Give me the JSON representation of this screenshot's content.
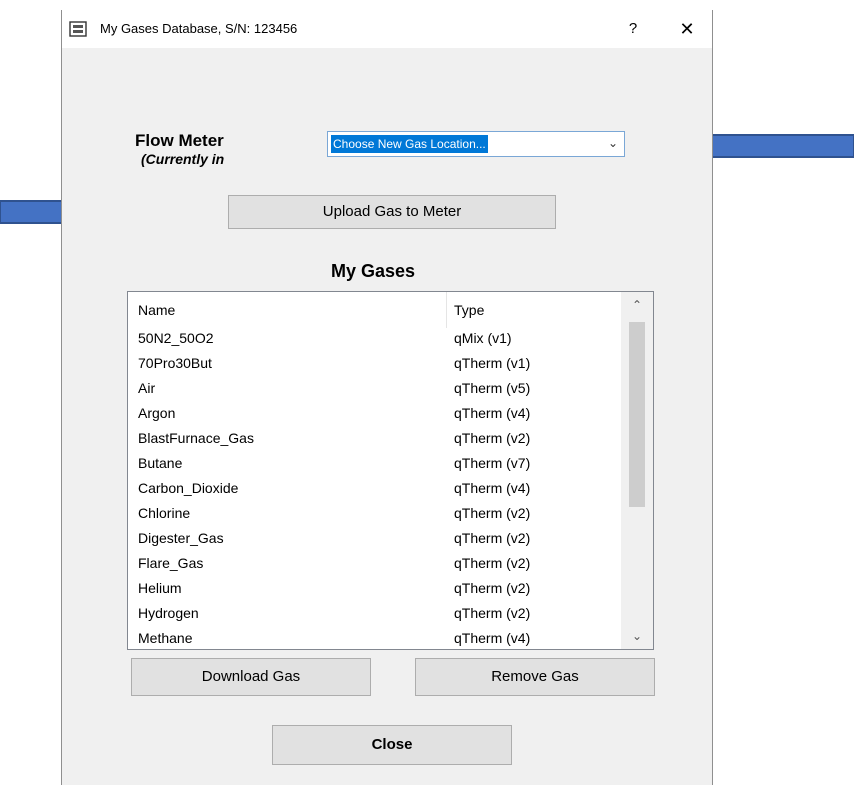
{
  "window": {
    "title": "My Gases Database, S/N: 123456",
    "help_label": "?",
    "close_label": "✕"
  },
  "flow_meter": {
    "label": "Flow Meter",
    "sublabel": "(Currently in",
    "dropdown_selected": "Choose New Gas Location...",
    "upload_button": "Upload Gas to Meter"
  },
  "my_gases": {
    "title": "My Gases",
    "columns": [
      "Name",
      "Type"
    ],
    "rows": [
      {
        "name": "50N2_50O2",
        "type": "qMix (v1)"
      },
      {
        "name": "70Pro30But",
        "type": "qTherm (v1)"
      },
      {
        "name": "Air",
        "type": "qTherm (v5)"
      },
      {
        "name": "Argon",
        "type": "qTherm (v4)"
      },
      {
        "name": "BlastFurnace_Gas",
        "type": "qTherm (v2)"
      },
      {
        "name": "Butane",
        "type": "qTherm (v7)"
      },
      {
        "name": "Carbon_Dioxide",
        "type": "qTherm (v4)"
      },
      {
        "name": "Chlorine",
        "type": "qTherm (v2)"
      },
      {
        "name": "Digester_Gas",
        "type": "qTherm (v2)"
      },
      {
        "name": "Flare_Gas",
        "type": "qTherm (v2)"
      },
      {
        "name": "Helium",
        "type": "qTherm (v2)"
      },
      {
        "name": "Hydrogen",
        "type": "qTherm (v2)"
      },
      {
        "name": "Methane",
        "type": "qTherm (v4)"
      }
    ]
  },
  "buttons": {
    "download": "Download Gas",
    "remove": "Remove Gas",
    "close": "Close"
  },
  "colors": {
    "arrow_fill": "#4472c4",
    "arrow_stroke": "#2f528f",
    "selection": "#0078d7"
  }
}
